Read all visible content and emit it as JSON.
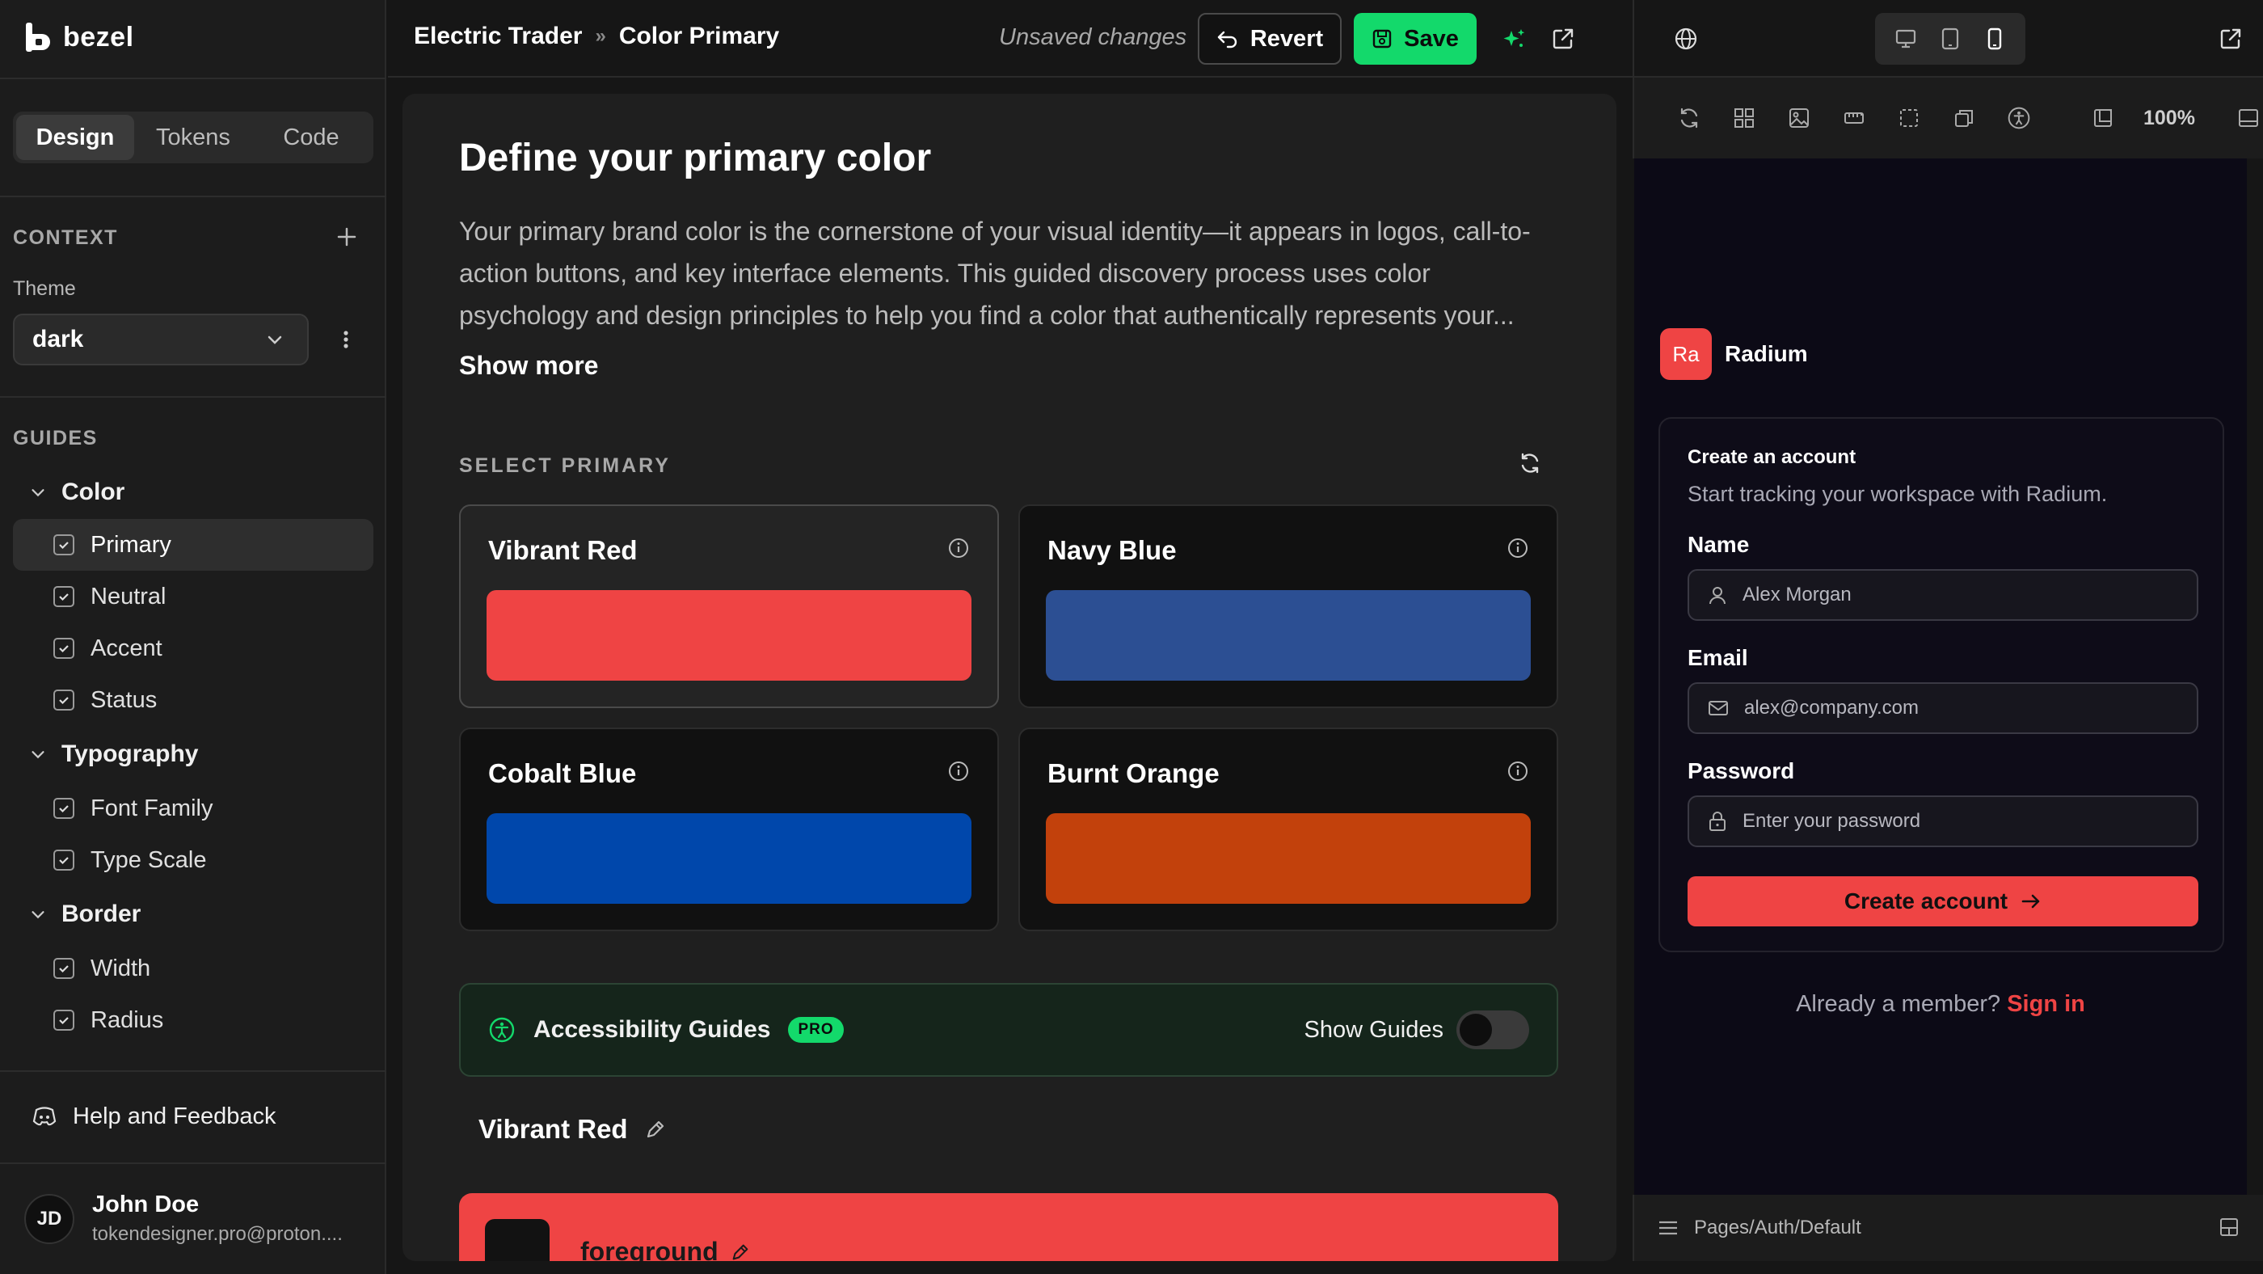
{
  "app": {
    "brand": "bezel"
  },
  "sidebar": {
    "tabs": [
      "Design",
      "Tokens",
      "Code"
    ],
    "active_tab": "Design",
    "context_label": "CONTEXT",
    "theme_label": "Theme",
    "theme_value": "dark",
    "guides_label": "GUIDES",
    "groups": [
      {
        "label": "Color",
        "items": [
          "Primary",
          "Neutral",
          "Accent",
          "Status"
        ]
      },
      {
        "label": "Typography",
        "items": [
          "Font Family",
          "Type Scale"
        ]
      },
      {
        "label": "Border",
        "items": [
          "Width",
          "Radius"
        ]
      }
    ],
    "active_item": "Primary",
    "help": "Help and Feedback",
    "user": {
      "initials": "JD",
      "name": "John Doe",
      "email": "tokendesigner.pro@proton...."
    }
  },
  "topbar": {
    "breadcrumb": [
      "Electric Trader",
      "Color Primary"
    ],
    "breadcrumb_sep": "»",
    "unsaved": "Unsaved changes",
    "revert": "Revert",
    "save": "Save"
  },
  "main": {
    "title": "Define your primary color",
    "description": "Your primary brand color is the cornerstone of your visual identity—it appears in logos, call-to-action buttons, and key interface elements. This guided discovery process uses color psychology and design principles to help you find a color that authentically represents your...",
    "show_more": "Show more",
    "select_label": "SELECT PRIMARY",
    "options": [
      {
        "name": "Vibrant Red",
        "color": "#ef4444",
        "selected": true
      },
      {
        "name": "Navy Blue",
        "color": "#2c4f93",
        "selected": false
      },
      {
        "name": "Cobalt Blue",
        "color": "#0047ab",
        "selected": false
      },
      {
        "name": "Burnt Orange",
        "color": "#c2410c",
        "selected": false
      }
    ],
    "accessibility": {
      "title": "Accessibility Guides",
      "badge": "PRO",
      "toggle_label": "Show Guides",
      "toggle_on": false
    },
    "selected_name": "Vibrant Red",
    "foreground_label": "foreground"
  },
  "preview": {
    "zoom": "100%",
    "brand_initials": "Ra",
    "brand_name": "Radium",
    "form_title": "Create an account",
    "form_subtitle": "Start tracking your workspace with Radium.",
    "fields": [
      {
        "label": "Name",
        "placeholder": "Alex Morgan",
        "icon": "user-icon"
      },
      {
        "label": "Email",
        "placeholder": "alex@company.com",
        "icon": "mail-icon"
      },
      {
        "label": "Password",
        "placeholder": "Enter your password",
        "icon": "lock-icon"
      }
    ],
    "submit": "Create account",
    "member_text": "Already a member?",
    "sign_in": "Sign in",
    "page_path": "Pages/Auth/Default"
  },
  "colors": {
    "accent_green": "#13d96b",
    "primary_red": "#ef4444"
  }
}
